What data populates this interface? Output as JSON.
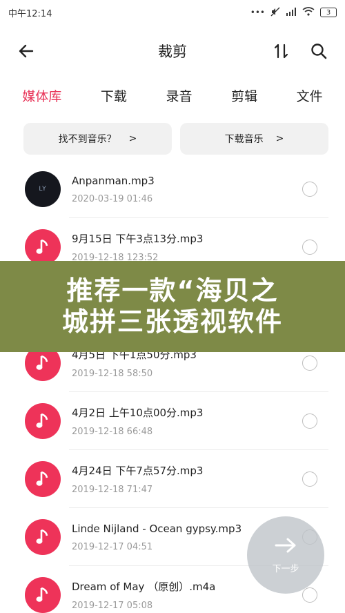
{
  "status_bar": {
    "time": "中午12:14",
    "icons": [
      "dots-icon",
      "mute-icon",
      "signal-icon",
      "wifi-icon"
    ],
    "battery": "3"
  },
  "app_bar": {
    "title": "裁剪",
    "left_icon": "back-arrow-icon",
    "right_icons": [
      "sort-icon",
      "search-icon"
    ]
  },
  "tabs": [
    {
      "label": "媒体库",
      "active": true
    },
    {
      "label": "下载",
      "active": false
    },
    {
      "label": "录音",
      "active": false
    },
    {
      "label": "剪辑",
      "active": false
    },
    {
      "label": "文件",
      "active": false
    }
  ],
  "quick_actions": [
    {
      "label": "找不到音乐？",
      "arrow": ">"
    },
    {
      "label": "下载音乐",
      "arrow": ">"
    }
  ],
  "files": [
    {
      "name": "Anpanman.mp3",
      "sub": "2020-03-19 01:46",
      "thumb": "LY",
      "style": "dark"
    },
    {
      "name": "9月15日 下午3点13分.mp3",
      "sub": "2019-12-18 123:52",
      "style": "pink"
    },
    {
      "name": "",
      "sub": "",
      "style": "pink"
    },
    {
      "name": "4月5日 下午1点50分.mp3",
      "sub": "2019-12-18 58:50",
      "style": "pink"
    },
    {
      "name": "4月2日 上午10点00分.mp3",
      "sub": "2019-12-18 66:48",
      "style": "pink"
    },
    {
      "name": "4月24日 下午7点57分.mp3",
      "sub": "2019-12-18 71:47",
      "style": "pink"
    },
    {
      "name": "Linde Nijland - Ocean gypsy.mp3",
      "sub": "2019-12-17 04:51",
      "style": "pink"
    },
    {
      "name": "Dream of May （原创）.m4a",
      "sub": "2019-12-17 05:08",
      "style": "pink"
    }
  ],
  "banner": {
    "line1": "推荐一款“海贝之",
    "line2": "城拼三张透视软件"
  },
  "fab": {
    "label": "下一步",
    "icon": "arrow-right-icon"
  },
  "colors": {
    "accent": "#e8365a",
    "banner_bg": "#7e8a47",
    "fab_bg": "#bec3c8"
  }
}
